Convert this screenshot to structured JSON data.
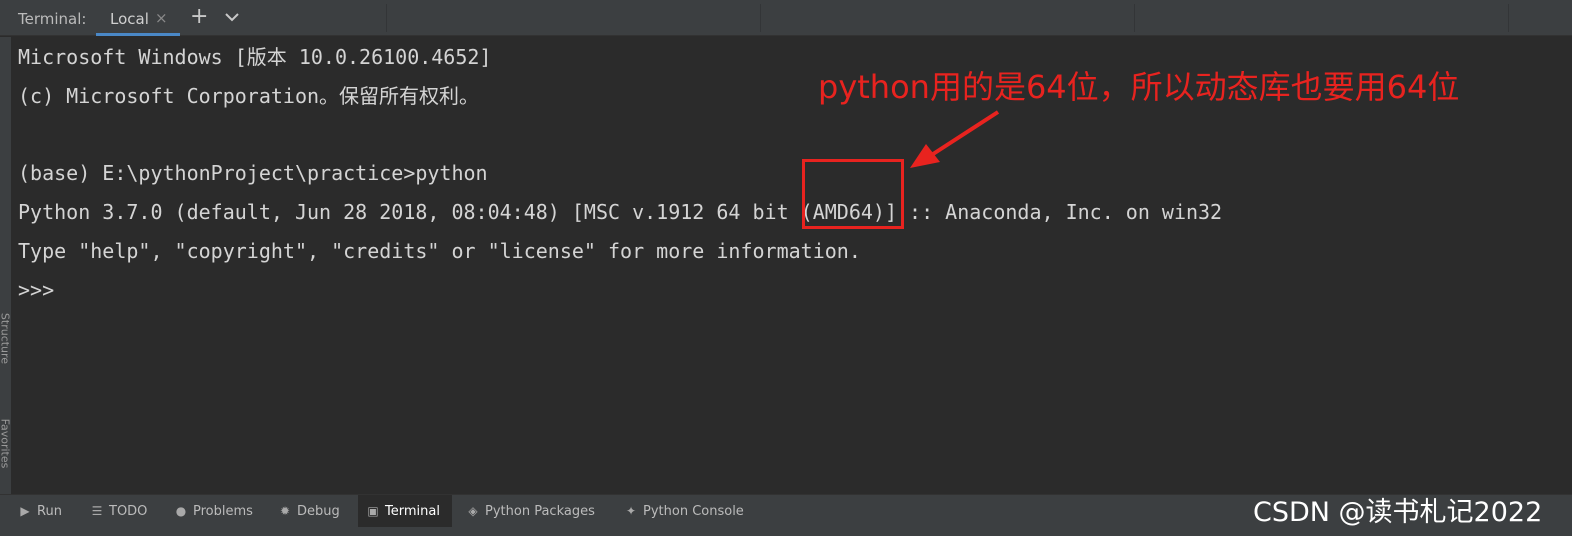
{
  "header": {
    "label": "Terminal:",
    "tab_label": "Local",
    "tab_close_glyph": "×",
    "add_glyph": "+",
    "icons": {
      "close": "close-icon",
      "add": "plus-icon",
      "menu": "chevron-down-icon"
    }
  },
  "sidebar": {
    "structure_label": "Structure",
    "favorites_label": "Favorites"
  },
  "terminal": {
    "lines": [
      "Microsoft Windows [版本 10.0.26100.4652]",
      "(c) Microsoft Corporation。保留所有权利。",
      "",
      "(base) E:\\pythonProject\\practice>python",
      "Python 3.7.0 (default, Jun 28 2018, 08:04:48) [MSC v.1912 64 bit (AMD64)] :: Anaconda, Inc. on win32",
      "Type \"help\", \"copyright\", \"credits\" or \"license\" for more information.",
      ">>>"
    ]
  },
  "annotation": {
    "text": "python用的是64位，所以动态库也要用64位",
    "color": "#e8231f"
  },
  "toolbar": {
    "items": [
      {
        "label": "Run",
        "icon": "play-icon"
      },
      {
        "label": "TODO",
        "icon": "list-icon"
      },
      {
        "label": "Problems",
        "icon": "info-icon"
      },
      {
        "label": "Debug",
        "icon": "bug-icon"
      },
      {
        "label": "Terminal",
        "icon": "terminal-icon",
        "active": true
      },
      {
        "label": "Python Packages",
        "icon": "layers-icon"
      },
      {
        "label": "Python Console",
        "icon": "python-icon"
      }
    ]
  },
  "watermark": "CSDN @读书札记2022",
  "colors": {
    "background": "#2b2b2b",
    "panel": "#3c3f41",
    "accent": "#4a88c7",
    "text": "#d4d4d4",
    "annotation": "#e8231f"
  }
}
